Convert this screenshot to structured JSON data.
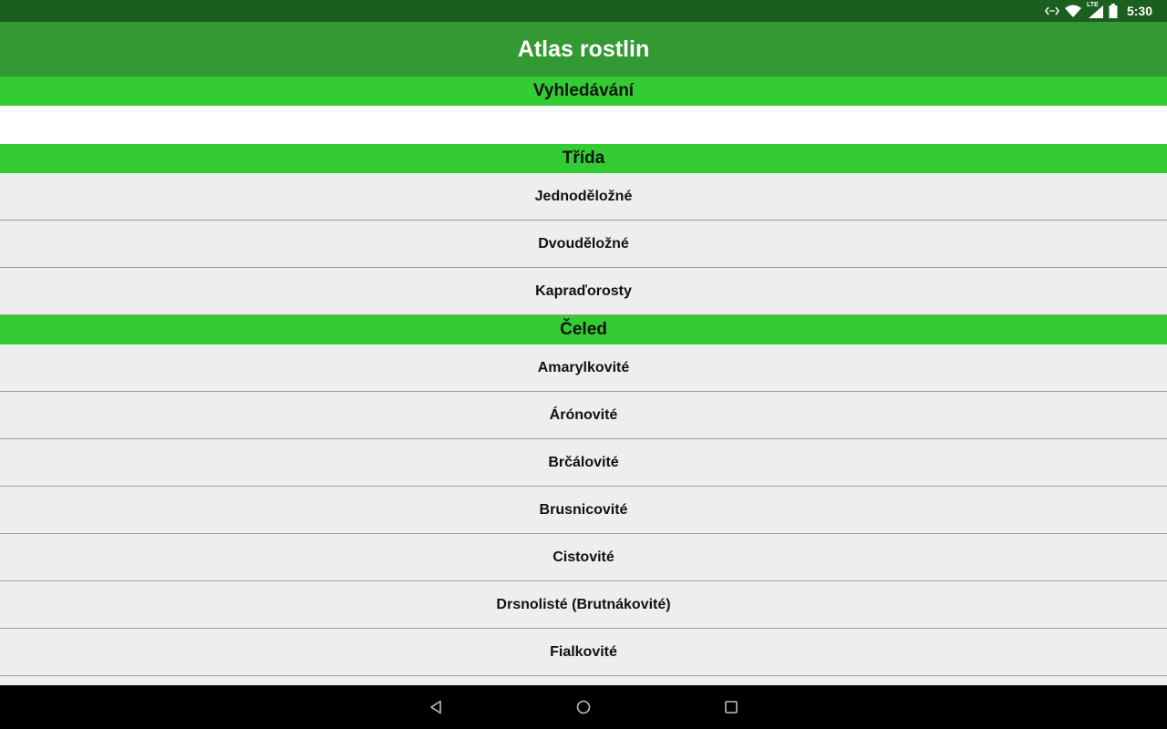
{
  "status_bar": {
    "time": "5:30",
    "network_label": "LTE",
    "icons": [
      "data-sync-icon",
      "wifi-icon",
      "cellular-signal-icon",
      "battery-icon"
    ]
  },
  "app_bar": {
    "title": "Atlas rostlin",
    "color": "#339933"
  },
  "sections": {
    "search": {
      "title": "Vyhledávání",
      "input_value": "",
      "placeholder": ""
    },
    "class": {
      "title": "Třída",
      "items": [
        "Jednoděložné",
        "Dvouděložné",
        "Kapraďorosty"
      ]
    },
    "family": {
      "title": "Čeled",
      "items": [
        "Amarylkovité",
        "Árónovité",
        "Brčálovité",
        "Brusnicovité",
        "Cistovité",
        "Drsnolisté (Brutnákovité)",
        "Fialkovité"
      ]
    }
  },
  "nav_bar": {
    "icons": [
      "back-icon",
      "home-icon",
      "recents-icon"
    ]
  },
  "colors": {
    "status_bar": "#1b5e20",
    "header_accent": "#33cc33",
    "list_background": "#eeeeee",
    "nav_bar": "#000000"
  }
}
